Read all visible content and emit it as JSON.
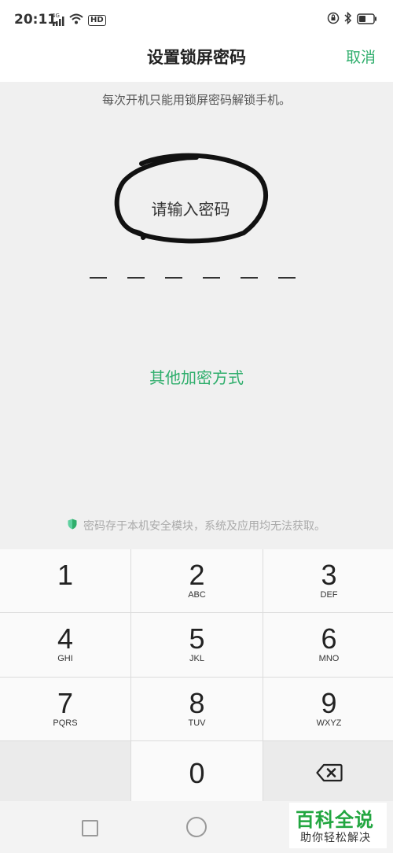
{
  "status_bar": {
    "time": "20:11",
    "network": "4G",
    "hd": "HD"
  },
  "header": {
    "title": "设置锁屏密码",
    "cancel_label": "取消"
  },
  "hint": "每次开机只能用锁屏密码解锁手机。",
  "prompt": "请输入密码",
  "password_length": 6,
  "other_methods_label": "其他加密方式",
  "security_note": "密码存于本机安全模块，系统及应用均无法获取。",
  "keypad": {
    "keys": [
      {
        "num": "1",
        "letters": ""
      },
      {
        "num": "2",
        "letters": "ABC"
      },
      {
        "num": "3",
        "letters": "DEF"
      },
      {
        "num": "4",
        "letters": "GHI"
      },
      {
        "num": "5",
        "letters": "JKL"
      },
      {
        "num": "6",
        "letters": "MNO"
      },
      {
        "num": "7",
        "letters": "PQRS"
      },
      {
        "num": "8",
        "letters": "TUV"
      },
      {
        "num": "9",
        "letters": "WXYZ"
      }
    ],
    "zero": "0",
    "delete_icon": "backspace-icon"
  },
  "watermark": {
    "main": "百科全说",
    "sub": "助你轻松解决"
  },
  "colors": {
    "accent": "#2fae6c",
    "watermark": "#22a640"
  }
}
